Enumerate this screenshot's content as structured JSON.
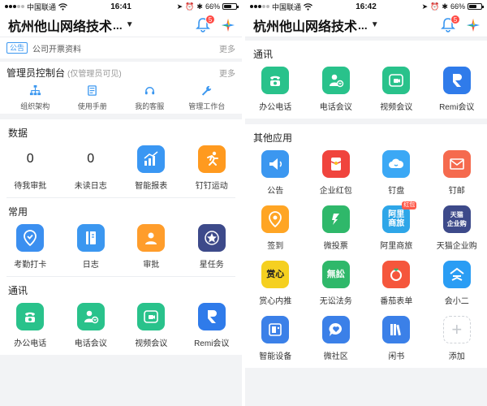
{
  "status_left": {
    "carrier": "中国联通",
    "time": "16:41",
    "battery": "66%",
    "battery_level": 0.66
  },
  "status_right": {
    "carrier": "中国联通",
    "time": "16:42",
    "battery": "66%",
    "battery_level": 0.66
  },
  "header": {
    "org_name": "杭州他山网络技术",
    "ellipsis": "...",
    "badge_count": "5"
  },
  "notice": {
    "tag": "公告",
    "text": "公司开票资料",
    "more": "更多"
  },
  "admin": {
    "title": "管理员控制台",
    "subtitle": "(仅管理员可见)",
    "more": "更多",
    "items": [
      "组织架构",
      "使用手册",
      "我的客服",
      "管理工作台"
    ]
  },
  "data_section": {
    "title": "数据",
    "items": [
      {
        "value": "0",
        "label": "待我审批"
      },
      {
        "value": "0",
        "label": "未读日志"
      },
      {
        "label": "智能报表",
        "icon": "chart-icon",
        "color": "#3a97f3"
      },
      {
        "label": "钉钉运动",
        "icon": "runner-icon",
        "color": "#ff9a1f"
      }
    ]
  },
  "common_section": {
    "title": "常用",
    "items": [
      {
        "label": "考勤打卡",
        "icon": "location-check-icon",
        "color": "#3b8ff0"
      },
      {
        "label": "日志",
        "icon": "notebook-icon",
        "color": "#3b97f0"
      },
      {
        "label": "审批",
        "icon": "person-card-icon",
        "color": "#ff9d2b"
      },
      {
        "label": "星任务",
        "icon": "star-badge-icon",
        "color": "#3d4a8a"
      }
    ]
  },
  "comm_section": {
    "title": "通讯",
    "items": [
      {
        "label": "办公电话",
        "icon": "phone-icon",
        "color": "#29c28b"
      },
      {
        "label": "电话会议",
        "icon": "phone-person-icon",
        "color": "#29c28b"
      },
      {
        "label": "视频会议",
        "icon": "video-call-icon",
        "color": "#29c28b"
      },
      {
        "label": "Remi会议",
        "icon": "remi-icon",
        "color": "#2f7bea"
      }
    ]
  },
  "other_section": {
    "title": "其他应用",
    "items": [
      {
        "label": "公告",
        "icon": "megaphone-icon",
        "color": "#3b97f0"
      },
      {
        "label": "企业红包",
        "icon": "red-packet-icon",
        "color": "#f0443d"
      },
      {
        "label": "钉盘",
        "icon": "cloud-icon",
        "color": "#3ba8f5"
      },
      {
        "label": "钉邮",
        "icon": "mail-icon",
        "color": "#f56a4e"
      },
      {
        "label": "签到",
        "icon": "pin-icon",
        "color": "#ffa524"
      },
      {
        "label": "微投票",
        "icon": "vote-icon",
        "color": "#2fb86a"
      },
      {
        "label": "阿里商旅",
        "icon": "ali-travel-icon",
        "color": "#2ea6e8",
        "icon_text": "阿里\n商旅",
        "tag": "红包"
      },
      {
        "label": "天猫企业购",
        "icon": "tmall-icon",
        "color": "#3d4a8a",
        "icon_text": "天猫\n企业购"
      },
      {
        "label": "赏心内推",
        "icon": "shangxin-icon",
        "color": "#f5d020",
        "icon_text": "赏心"
      },
      {
        "label": "无讼法务",
        "icon": "wusong-icon",
        "color": "#2fb86a",
        "icon_text": "無訟"
      },
      {
        "label": "番茄表单",
        "icon": "tomato-icon",
        "color": "#f5563c"
      },
      {
        "label": "会小二",
        "icon": "hui-icon",
        "color": "#2a9df4"
      },
      {
        "label": "智能设备",
        "icon": "device-icon",
        "color": "#3b80e8"
      },
      {
        "label": "微社区",
        "icon": "chat-heart-icon",
        "color": "#3b80e8"
      },
      {
        "label": "闲书",
        "icon": "books-icon",
        "color": "#3b80e8"
      },
      {
        "label": "添加",
        "icon": "plus-icon",
        "color": "#ffffff"
      }
    ]
  }
}
